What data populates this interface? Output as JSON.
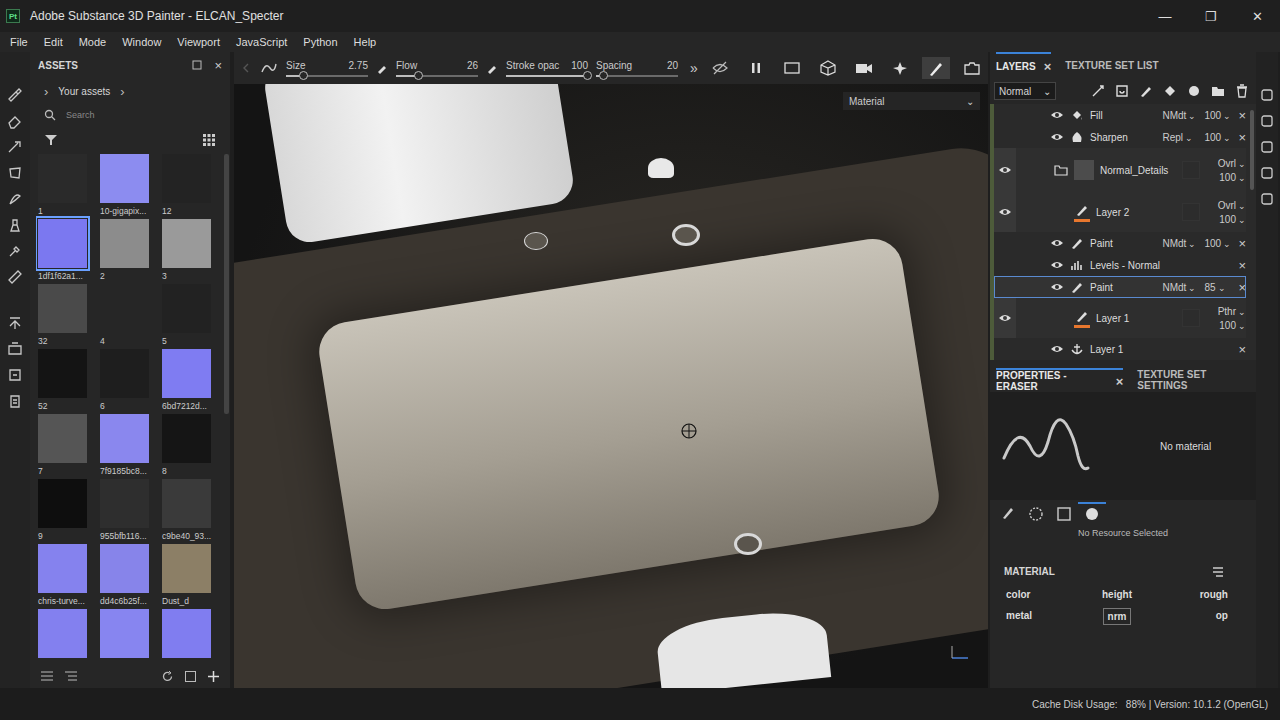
{
  "window": {
    "badge": "Pt",
    "title": "Adobe Substance 3D Painter - ELCAN_Specter",
    "controls": [
      "—",
      "❐",
      "✕"
    ]
  },
  "menu": [
    "File",
    "Edit",
    "Mode",
    "Window",
    "Viewport",
    "JavaScript",
    "Python",
    "Help"
  ],
  "assets": {
    "title": "ASSETS",
    "close": "×",
    "breadcrumb": "Your assets",
    "arrow": "›",
    "search": {
      "placeholder": "Search"
    },
    "items": [
      {
        "label": "1",
        "color": "#2a2a2a",
        "selected": false
      },
      {
        "label": "10-gigapix...",
        "color": "#8c8cf0",
        "selected": false
      },
      {
        "label": "12",
        "color": "#232323",
        "selected": false
      },
      {
        "label": "1df1f62a1...",
        "color": "#7b78f0",
        "selected": true
      },
      {
        "label": "2",
        "color": "#8c8c8c",
        "selected": false
      },
      {
        "label": "3",
        "color": "#9a9a9a",
        "selected": false
      },
      {
        "label": "32",
        "color": "#4a4a4a",
        "selected": false
      },
      {
        "label": "4",
        "color": "#262626",
        "selected": false
      },
      {
        "label": "5",
        "color": "#222222",
        "selected": false
      },
      {
        "label": "52",
        "color": "#141414",
        "selected": false
      },
      {
        "label": "6",
        "color": "#1e1e1e",
        "selected": false
      },
      {
        "label": "6bd7212d...",
        "color": "#7f7cf2",
        "selected": false
      },
      {
        "label": "7",
        "color": "#555555",
        "selected": false
      },
      {
        "label": "7f9185bc8...",
        "color": "#8a87ee",
        "selected": false
      },
      {
        "label": "8",
        "color": "#151515",
        "selected": false
      },
      {
        "label": "9",
        "color": "#0e0e0e",
        "selected": false
      },
      {
        "label": "955bfb116...",
        "color": "#2e2e2e",
        "selected": false
      },
      {
        "label": "c9be40_93...",
        "color": "#3a3a3a",
        "selected": false
      },
      {
        "label": "chris-turve...",
        "color": "#8582ee",
        "selected": false
      },
      {
        "label": "dd4c6b25f...",
        "color": "#8784ea",
        "selected": false
      },
      {
        "label": "Dust_d",
        "color": "#8c7f66",
        "selected": false
      },
      {
        "label": "",
        "color": "#8380ef",
        "selected": false
      },
      {
        "label": "",
        "color": "#8785f0",
        "selected": false
      },
      {
        "label": "",
        "color": "#807df0",
        "selected": false
      }
    ]
  },
  "toolbar": {
    "sliders": [
      {
        "label": "Size",
        "value": "2.75",
        "level": 0.22
      },
      {
        "label": "Flow",
        "value": "26",
        "level": 0.28
      },
      {
        "label": "Stroke opac",
        "value": "100",
        "level": 1
      },
      {
        "label": "Spacing",
        "value": "20",
        "level": 0.1
      }
    ],
    "more": "»"
  },
  "viewport": {
    "channel": "Material",
    "chevron": "⌄"
  },
  "layers": {
    "tabs": [
      {
        "label": "LAYERS",
        "selected": true
      },
      {
        "label": "TEXTURE SET LIST",
        "selected": false
      }
    ],
    "close": "×",
    "blend": "Normal",
    "chevron": "⌄",
    "rows": [
      {
        "kind": "fill",
        "name": "Fill",
        "blend": "NMdt",
        "opacity": "100",
        "visible": true,
        "selected": false
      },
      {
        "kind": "filter",
        "name": "Sharpen",
        "blend": "Repl",
        "opacity": "100",
        "visible": true,
        "selected": false
      },
      {
        "kind": "folder",
        "name": "Normal_Details",
        "blend": "Ovrl",
        "opacity": "100",
        "visible": true,
        "selected": false
      },
      {
        "kind": "layer",
        "name": "Layer 2",
        "blend": "Ovrl",
        "opacity": "100",
        "visible": true,
        "selected": false
      },
      {
        "kind": "paint",
        "name": "Paint",
        "blend": "NMdt",
        "opacity": "100",
        "visible": true,
        "selected": false
      },
      {
        "kind": "levels",
        "name": "Levels - Normal",
        "visible": true,
        "selected": false
      },
      {
        "kind": "paint",
        "name": "Paint",
        "blend": "NMdt",
        "opacity": "85",
        "visible": true,
        "selected": true
      },
      {
        "kind": "layer",
        "name": "Layer 1",
        "blend": "Pthr",
        "opacity": "100",
        "visible": true,
        "selected": false
      },
      {
        "kind": "anchor",
        "name": "Layer 1",
        "visible": true,
        "selected": false
      }
    ]
  },
  "properties": {
    "tabs": [
      {
        "label": "PROPERTIES - ERASER",
        "selected": true
      },
      {
        "label": "TEXTURE SET SETTINGS",
        "selected": false
      }
    ],
    "close": "×",
    "preview_text": "No material",
    "resource_tabs": [
      {
        "selected": false
      },
      {
        "selected": false
      },
      {
        "selected": false
      },
      {
        "selected": true
      }
    ],
    "resource": "No Resource Selected",
    "material_title": "MATERIAL",
    "channels": [
      {
        "label": "color",
        "selected": false
      },
      {
        "label": "height",
        "selected": false
      },
      {
        "label": "rough",
        "selected": false
      },
      {
        "label": "metal",
        "selected": false
      },
      {
        "label": "nrm",
        "selected": true
      },
      {
        "label": "op",
        "selected": false
      }
    ]
  },
  "status_bar": "Cache Disk Usage:   88% | Version: 10.1.2 (OpenGL)"
}
